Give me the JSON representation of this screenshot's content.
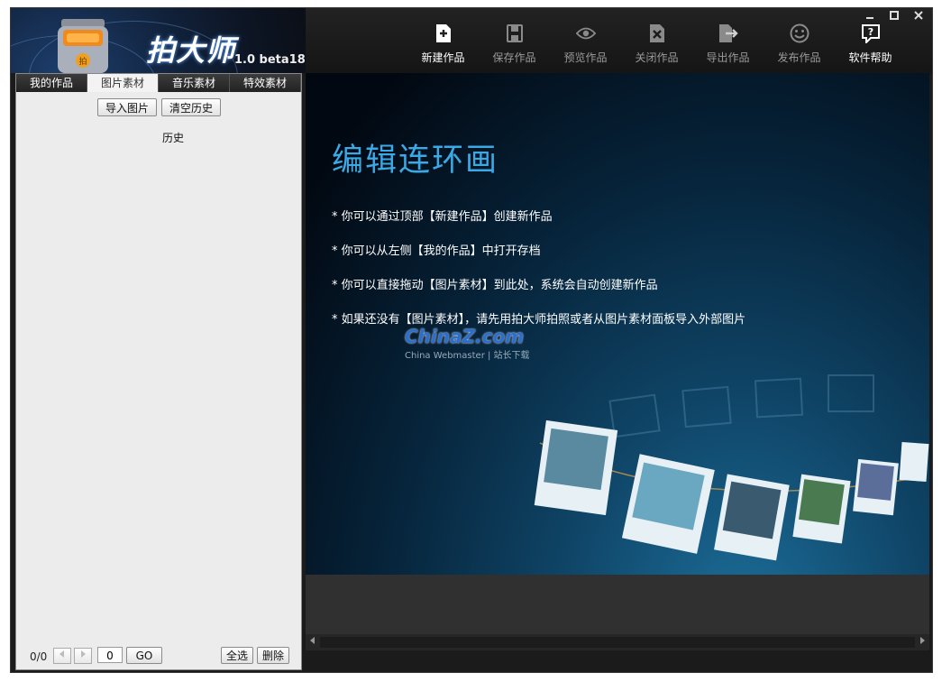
{
  "window": {
    "app_name": "拍大师",
    "version": "1.0 beta18",
    "controls": [
      "minimize",
      "maximize",
      "close"
    ]
  },
  "toolbar": {
    "buttons": [
      {
        "label": "新建作品",
        "icon": "new-document-icon",
        "active": true
      },
      {
        "label": "保存作品",
        "icon": "save-icon",
        "active": false
      },
      {
        "label": "预览作品",
        "icon": "eye-icon",
        "active": false
      },
      {
        "label": "关闭作品",
        "icon": "close-document-icon",
        "active": false
      },
      {
        "label": "导出作品",
        "icon": "export-icon",
        "active": false
      },
      {
        "label": "发布作品",
        "icon": "smiley-icon",
        "active": false
      },
      {
        "label": "软件帮助",
        "icon": "help-icon",
        "active": true
      }
    ]
  },
  "left_panel": {
    "tabs": [
      {
        "label": "我的作品",
        "active": false
      },
      {
        "label": "图片素材",
        "active": true
      },
      {
        "label": "音乐素材",
        "active": false
      },
      {
        "label": "特效素材",
        "active": false
      }
    ],
    "import_button": "导入图片",
    "clear_button": "清空历史",
    "history_label": "历史",
    "pager_count": "0/0",
    "page_input": "0",
    "go_button": "GO",
    "select_all_button": "全选",
    "delete_button": "删除"
  },
  "stage": {
    "title": "编辑连环画",
    "bullets": [
      "* 你可以通过顶部【新建作品】创建新作品",
      "* 你可以从左侧【我的作品】中打开存档",
      "* 你可以直接拖动【图片素材】到此处，系统会自动创建新作品",
      "* 如果还没有【图片素材】，请先用拍大师拍照或者从图片素材面板导入外部图片"
    ],
    "watermark_main": "ChinaZ.com",
    "watermark_sub": "China Webmaster | 站长下载"
  },
  "colors": {
    "accent_blue": "#3aa9e6",
    "window_bg": "#1b1b1b",
    "panel_bg": "#ececec"
  }
}
